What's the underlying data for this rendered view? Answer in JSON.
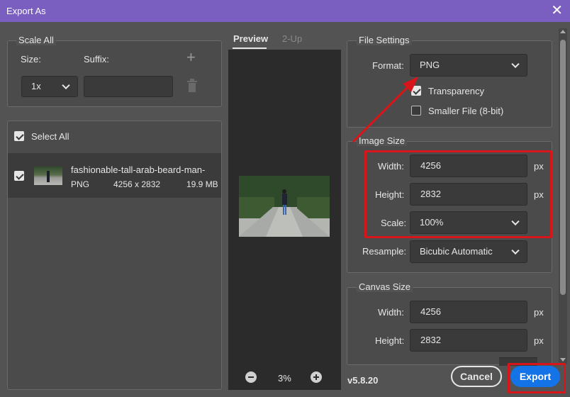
{
  "window": {
    "title": "Export As",
    "close_glyph": "✕"
  },
  "scale_all": {
    "legend": "Scale All",
    "size_label": "Size:",
    "suffix_label": "Suffix:",
    "size_value": "1x",
    "suffix_value": "",
    "add_glyph": "+"
  },
  "select_all": {
    "label": "Select All",
    "checked": true
  },
  "assets": [
    {
      "name": "fashionable-tall-arab-beard-man-",
      "format": "PNG",
      "dimensions": "4256 x 2832",
      "size": "19.9 MB",
      "checked": true
    }
  ],
  "preview": {
    "tabs": [
      "Preview",
      "2-Up"
    ],
    "active_tab": "Preview",
    "zoom": "3%",
    "zoom_out_glyph": "−",
    "zoom_in_glyph": "+"
  },
  "file_settings": {
    "legend": "File Settings",
    "format_label": "Format:",
    "format_value": "PNG",
    "transparency_label": "Transparency",
    "transparency_checked": true,
    "smaller_file_label": "Smaller File (8-bit)",
    "smaller_file_checked": false
  },
  "image_size": {
    "legend": "Image Size",
    "width_label": "Width:",
    "width_value": "4256",
    "height_label": "Height:",
    "height_value": "2832",
    "unit": "px",
    "scale_label": "Scale:",
    "scale_value": "100%",
    "resample_label": "Resample:",
    "resample_value": "Bicubic Automatic"
  },
  "canvas_size": {
    "legend": "Canvas Size",
    "width_label": "Width:",
    "width_value": "4256",
    "height_label": "Height:",
    "height_value": "2832",
    "unit": "px"
  },
  "footer": {
    "version": "v5.8.20",
    "cancel_label": "Cancel",
    "export_label": "Export"
  },
  "colors": {
    "titlebar": "#7a5fc0",
    "dialog_bg": "#535353",
    "highlight_red": "#d8151a",
    "export_blue": "#1473e6"
  }
}
